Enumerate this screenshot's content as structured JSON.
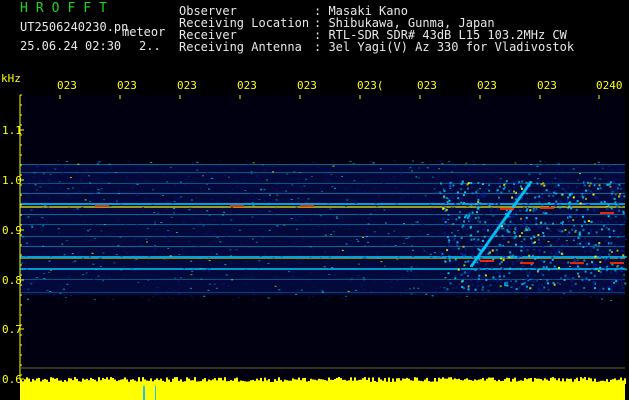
{
  "app": {
    "logo": "HROFFT",
    "file_name": "UT2506240230.pn",
    "file_suffix": "meteor",
    "date_time": "25.06.24 02:30",
    "counter": "2.."
  },
  "header": {
    "labels": [
      "Observer",
      "Receiving Location",
      "Receiver",
      "Receiving Antenna"
    ],
    "values": [
      ": Masaki Kano",
      ": Shibukawa, Gunma, Japan",
      ": RTL-SDR SDR# 43dB L15 103.2MHz CW",
      ": 3el Yagi(V) Az 330 for Vladivostok"
    ]
  },
  "spectrogram": {
    "y_unit": "kHz",
    "y_ticks": [
      "1.1",
      "1.0",
      "0.9",
      "0.8",
      "0.7",
      "0.6"
    ],
    "x_ticks": [
      "023",
      "023",
      "023",
      "023",
      "023",
      "023(",
      "023",
      "023",
      "023",
      "0240"
    ],
    "colors": {
      "background": "#000010",
      "noise": "#0a1a8a",
      "mid": "#00c8ff",
      "hot": "#ffff00",
      "peak": "#ff2a00",
      "axis": "#ffff00",
      "level_bar": "#ffff00"
    }
  }
}
